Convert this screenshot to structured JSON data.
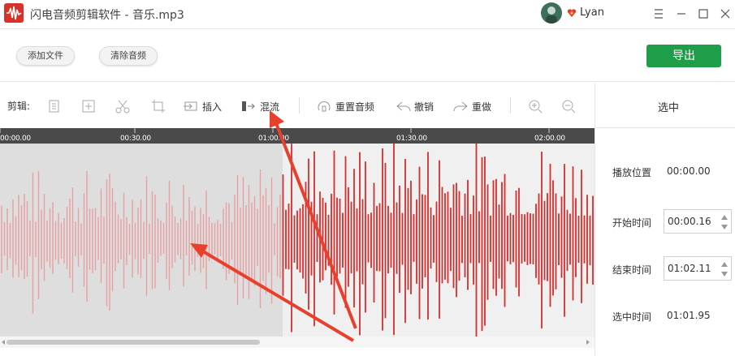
{
  "window": {
    "title": "闪电音频剪辑软件 - 音乐.mp3",
    "user": "Lyan"
  },
  "toolbar": {
    "add_file": "添加文件",
    "clear_audio": "清除音频",
    "export": "导出"
  },
  "edit": {
    "label": "剪辑:",
    "insert": "插入",
    "mix": "混流",
    "reset": "重置音频",
    "undo": "撤销",
    "redo": "重做"
  },
  "timeline": {
    "ticks": [
      "00:00.00",
      "00:30.00",
      "01:00.00",
      "01:30.00",
      "02:00.00"
    ]
  },
  "side": {
    "header": "选中",
    "play_pos_label": "播放位置",
    "play_pos": "00:00.00",
    "start_label": "开始时间",
    "start": "00:00.16",
    "end_label": "结束时间",
    "end": "01:02.11",
    "sel_label": "选中时间",
    "sel": "01:01.95"
  },
  "colors": {
    "accent": "#1e9e49",
    "wave": "#d32f2f",
    "wave_selected": "#e8a0a0",
    "arrow": "#e8402c"
  }
}
